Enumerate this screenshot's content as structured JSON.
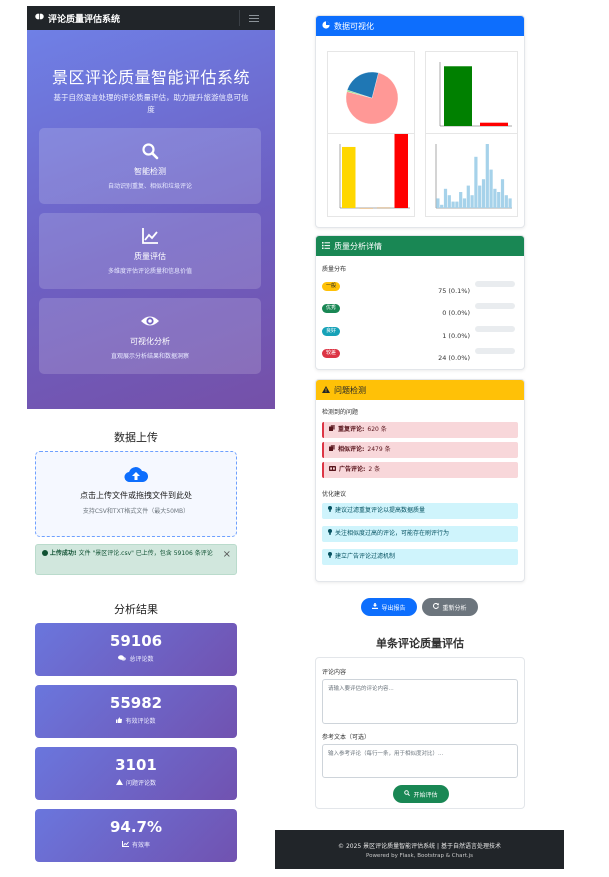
{
  "navbar": {
    "brand": "评论质量评估系统",
    "logo_icon": "brain-icon",
    "toggler_icon": "hamburger-icon"
  },
  "hero": {
    "title": "景区评论质量智能评估系统",
    "subtitle": "基于自然语言处理的评论质量评估，助力提升旅游信息可信度",
    "features": [
      {
        "icon": "search-icon",
        "name": "智能检测",
        "desc": "自动识别重复、相似和垃圾评论"
      },
      {
        "icon": "chart-line-icon",
        "name": "质量评估",
        "desc": "多维度评估评论质量和信息价值"
      },
      {
        "icon": "eye-icon",
        "name": "可视化分析",
        "desc": "直观展示分析结果和数据洞察"
      }
    ]
  },
  "upload": {
    "section_title": "数据上传",
    "icon": "cloud-upload-icon",
    "text": "点击上传文件或拖拽文件到此处",
    "hint": "支持CSV和TXT格式文件（最大50MB）"
  },
  "alert": {
    "icon": "check-circle-icon",
    "strong": "上传成功!",
    "message": "文件 \"景区评论.csv\" 已上传，包含 59106 条评论",
    "close": "×"
  },
  "results": {
    "section_title": "分析结果",
    "stats": [
      {
        "value": "59106",
        "label": "总评论数",
        "icon": "comments-icon"
      },
      {
        "value": "55982",
        "label": "有效评论数",
        "icon": "thumbs-up-icon"
      },
      {
        "value": "3101",
        "label": "问题评论数",
        "icon": "warning-icon"
      },
      {
        "value": "94.7%",
        "label": "有效率",
        "icon": "chart-line-icon"
      }
    ]
  },
  "viz": {
    "title": "数据可视化",
    "icon": "pie-chart-icon"
  },
  "chart_data": [
    {
      "type": "pie",
      "title": "",
      "values": [
        75,
        0,
        1,
        24
      ],
      "colors": [
        "#ff9896",
        "#2ca02c",
        "#98df8a",
        "#1f77b4"
      ]
    },
    {
      "type": "bar",
      "title": "",
      "categories": [
        "",
        ""
      ],
      "values": [
        56000,
        3100
      ],
      "colors": [
        "#008000",
        "#ff0000"
      ],
      "ylim": [
        0,
        60000
      ]
    },
    {
      "type": "bar",
      "title": "",
      "categories": [
        "",
        "",
        "",
        ""
      ],
      "values": [
        620,
        0,
        2,
        2479
      ],
      "colors": [
        "#ffd700",
        "#ff8c00",
        "#ff8c00",
        "#ff0000"
      ],
      "ylim": [
        0,
        650
      ]
    },
    {
      "type": "bar",
      "title": "",
      "values": [
        0.15,
        0.05,
        0.3,
        0.2,
        0.1,
        0.1,
        0.25,
        0.15,
        0.35,
        0.2,
        0.8,
        0.35,
        0.45,
        1.0,
        0.6,
        0.3,
        0.25,
        0.45,
        0.2,
        0.15
      ],
      "colors": [
        "#a6d2ea"
      ],
      "ylim": [
        0,
        1
      ]
    }
  ],
  "quality": {
    "title": "质量分析详情",
    "icon": "list-icon",
    "dist_label": "质量分布",
    "rows": [
      {
        "badge": "一般",
        "color": "#ffc107",
        "text_color": "#212529",
        "value": "75 (0.1%)"
      },
      {
        "badge": "优秀",
        "color": "#198754",
        "text_color": "#ffffff",
        "value": "0 (0.0%)"
      },
      {
        "badge": "良好",
        "color": "#17a2b8",
        "text_color": "#ffffff",
        "value": "1 (0.0%)"
      },
      {
        "badge": "较差",
        "color": "#dc3545",
        "text_color": "#ffffff",
        "value": "24 (0.0%)"
      }
    ]
  },
  "problems": {
    "title": "问题检测",
    "icon": "warning-icon",
    "detected_label": "检测到的问题",
    "items": [
      {
        "icon": "copy-icon",
        "label": "重复评论:",
        "value": "620 条"
      },
      {
        "icon": "clone-icon",
        "label": "相似评论:",
        "value": "2479 条"
      },
      {
        "icon": "ad-icon",
        "label": "广告评论:",
        "value": "2 条"
      }
    ],
    "suggest_label": "优化建议",
    "suggestions": [
      {
        "icon": "lightbulb-icon",
        "text": "建议过滤重复评论以提高数据质量"
      },
      {
        "icon": "lightbulb-icon",
        "text": "关注相似度过高的评论，可能存在刷评行为"
      },
      {
        "icon": "lightbulb-icon",
        "text": "建立广告评论过滤机制"
      }
    ]
  },
  "actions": {
    "export": {
      "label": "导出报告",
      "icon": "download-icon",
      "color": "#0d6efd"
    },
    "reanalyze": {
      "label": "重新分析",
      "icon": "refresh-icon",
      "color": "#6c757d"
    }
  },
  "single_eval": {
    "title": "单条评论质量评估",
    "content_label": "评论内容",
    "content_placeholder": "请输入要评估的评论内容...",
    "ref_label": "参考文本（可选）",
    "ref_placeholder": "输入参考评论（每行一条，用于相似度对比）...",
    "button": "开始评估",
    "button_icon": "search-icon"
  },
  "footer": {
    "line1": "© 2025 景区评论质量智能评估系统 | 基于自然语言处理技术",
    "line2": "Powered by Flask, Bootstrap & Chart.js"
  }
}
